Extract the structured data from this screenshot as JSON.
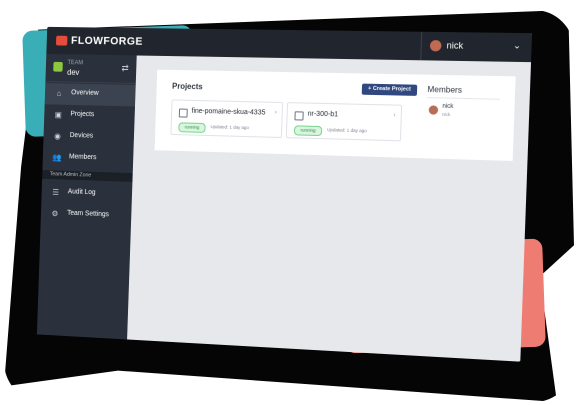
{
  "brand": {
    "name": "FLOWFORGE"
  },
  "user_menu": {
    "avatar_initials": "",
    "username": "nick",
    "chevron": "⌄"
  },
  "team": {
    "label": "TEAM",
    "name": "dev",
    "switch_icon": "swap-icon"
  },
  "sidebar": {
    "items": [
      {
        "label": "Overview",
        "icon": "home-icon",
        "active": true
      },
      {
        "label": "Projects",
        "icon": "projects-icon",
        "active": false
      },
      {
        "label": "Devices",
        "icon": "devices-icon",
        "active": false
      },
      {
        "label": "Members",
        "icon": "members-icon",
        "active": false
      }
    ],
    "admin_section_label": "Team Admin Zone",
    "admin_items": [
      {
        "label": "Audit Log",
        "icon": "database-icon"
      },
      {
        "label": "Team Settings",
        "icon": "gear-icon"
      }
    ]
  },
  "projects": {
    "title": "Projects",
    "create_label": "+ Create Project",
    "cards": [
      {
        "name": "fine-pomaine-skua-4335",
        "status": "running",
        "updated": "Updated: 1 day ago"
      },
      {
        "name": "nr-300-b1",
        "status": "running",
        "updated": "Updated: 1 day ago"
      }
    ]
  },
  "members": {
    "title": "Members",
    "items": [
      {
        "name": "nick",
        "role": "nick"
      }
    ]
  },
  "colors": {
    "topbar": "#21262e",
    "sidebar": "#2b313c",
    "accent_blue": "#31477f",
    "running_green": "#2f8b45",
    "logo_red": "#e64b3b",
    "teal_accent": "#3aaeb6",
    "coral_accent": "#ef7c72"
  }
}
